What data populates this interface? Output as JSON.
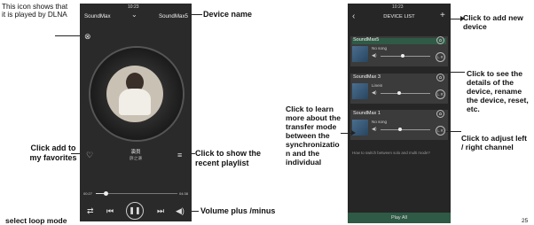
{
  "left_phone": {
    "status_time": "10:23",
    "title_left": "SoundMax",
    "title_right": "SoundMax5",
    "song_title": "演员",
    "artist": "薛之谦",
    "time_elapsed": "00:27",
    "time_total": "04:38",
    "progress": 0.12
  },
  "left_annotations": {
    "dlna": "This icon shows that it is played by DLNA",
    "device_name": "Device name",
    "favorites": "Click add to my favorites",
    "playlist": "Click to show the recent playlist",
    "volume": "Volume plus /minus",
    "loop": "select loop mode"
  },
  "right_phone": {
    "status_time": "10:23",
    "header_title": "DEVICE LIST",
    "devices": [
      {
        "name": "SoundMax5",
        "song": "No song",
        "volume": 0.45
      },
      {
        "name": "SoundMax 3",
        "song": "Linein",
        "volume": 0.38
      },
      {
        "name": "SoundMax 1",
        "song": "No song",
        "volume": 0.4
      }
    ],
    "help_text": "How to switch between solo and multi mode?",
    "play_all": "Play All"
  },
  "right_annotations": {
    "add_device": "Click to add new device",
    "details": "Click to see the details of the device, rename the device, reset, etc.",
    "transfer": "Click to learn more about the transfer mode between the synchronizatio n and the individual",
    "adjust": "Click to adjust left / right channel"
  },
  "page_number": "25",
  "icons": [
    "dlna-icon",
    "heart-icon",
    "playlist-icon",
    "loop-icon",
    "prev-icon",
    "pause-icon",
    "next-icon",
    "volume-icon",
    "gear-icon",
    "add-icon",
    "back-icon",
    "lr-channel-icon"
  ]
}
